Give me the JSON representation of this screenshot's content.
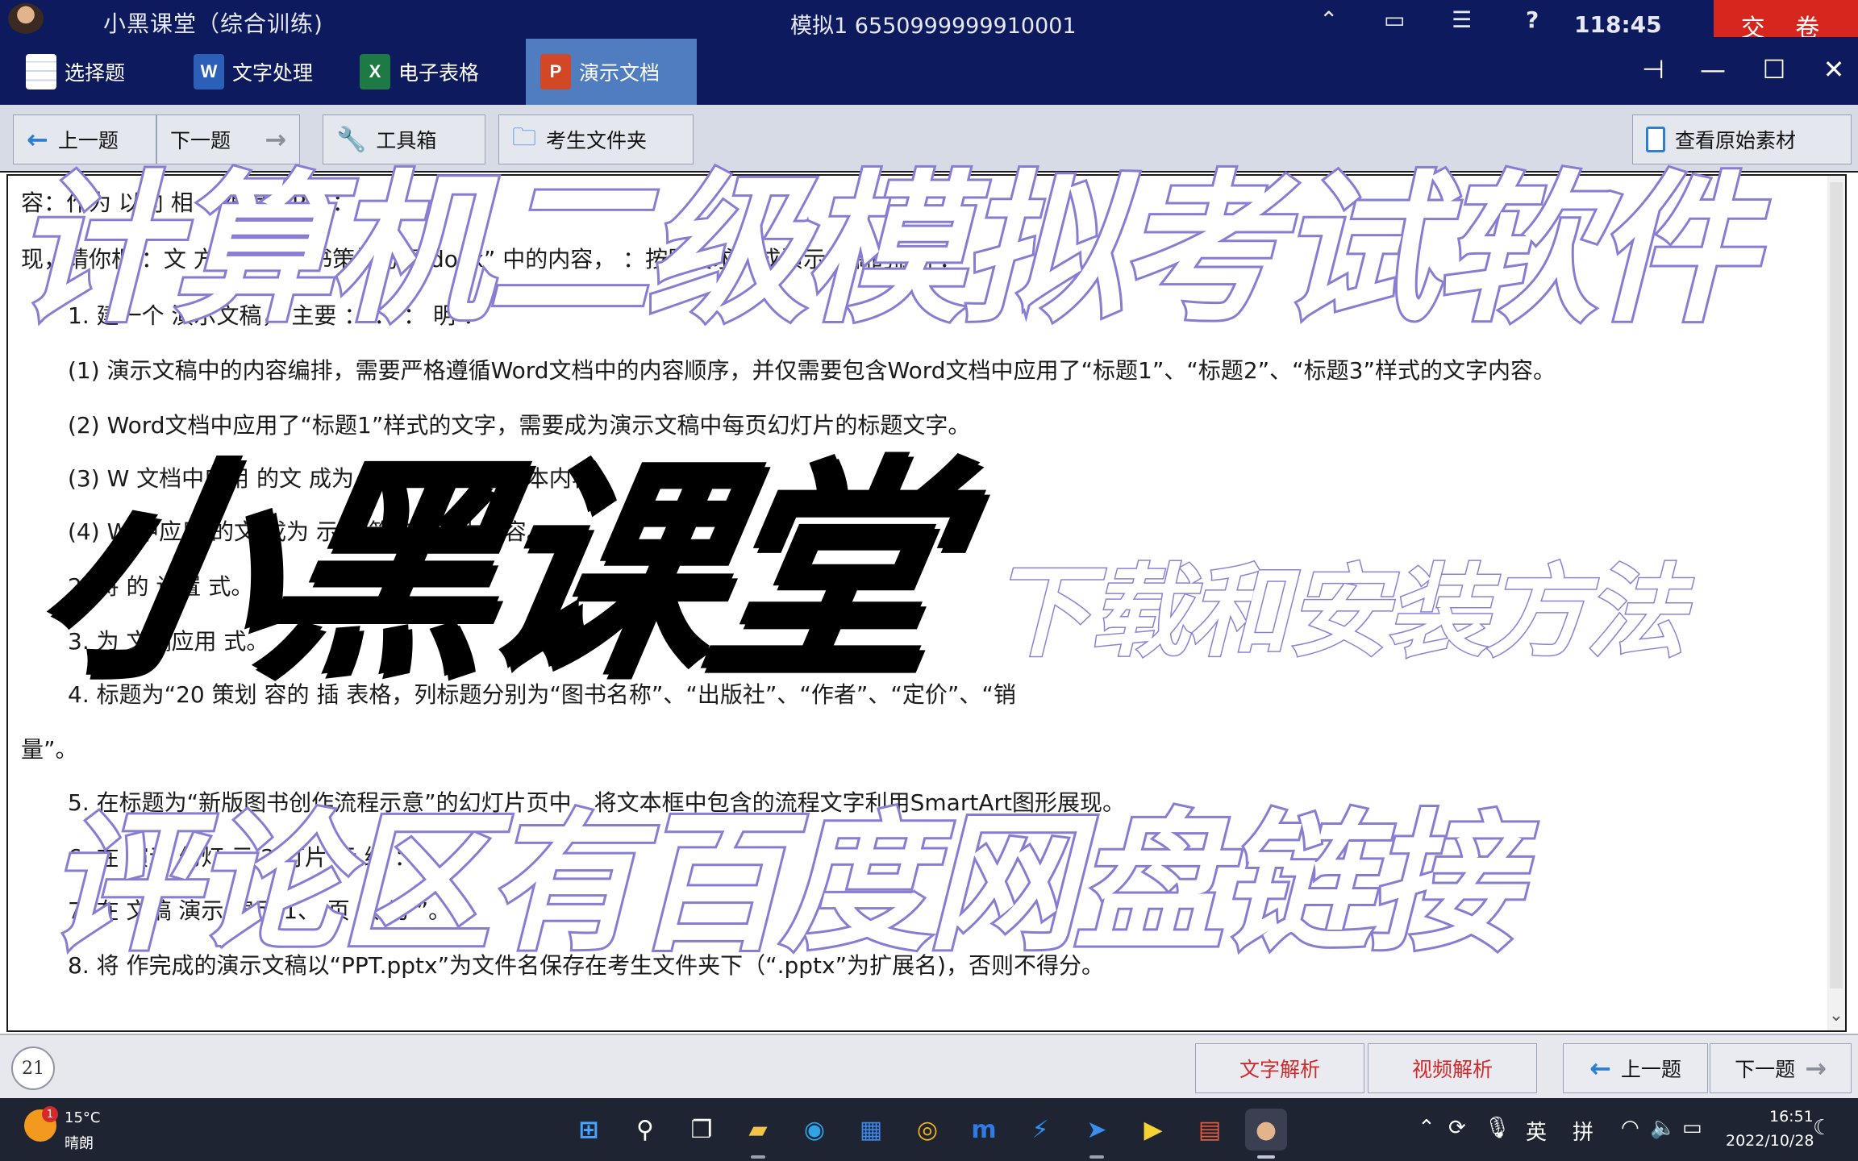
{
  "topbar": {
    "title": "小黑课堂（综合训练)",
    "exam_id": "模拟1  6550999999910001",
    "timer": "118:45",
    "submit_label": "交 卷",
    "icons": [
      "up-icon",
      "window-icon",
      "list-icon",
      "help-icon"
    ]
  },
  "tabs": [
    {
      "label": "选择题",
      "icon": "quiz"
    },
    {
      "label": "文字处理",
      "icon": "W"
    },
    {
      "label": "电子表格",
      "icon": "X"
    },
    {
      "label": "演示文档",
      "icon": "P"
    }
  ],
  "toolbar": {
    "prev_label": "上一题",
    "next_label": "下一题",
    "toolbox_label": "工具箱",
    "folder_label": "考生文件夹",
    "view_original_label": "查看原始素材"
  },
  "content": {
    "lines": [
      "容：作为  以向  相  ：编  大  rPoi  ：",
      "现，请你根  ：文  方  中的  “图书策划方案.docx”  中的内容，  ：按照要求完成演示文稿的制作：",
      "1.  建一个  演示文稿，  主要  ：  ：  ：  明  ：",
      "(1)   演示文稿中的内容编排，需要严格遵循Word文档中的内容顺序，并仅需要包含Word文档中应用了“标题1”、“标题2”、“标题3”样式的文字内容。",
      "(2)   Word文档中应用了“标题1”样式的文字，需要成为演示文稿中每页幻灯片的标题文字。",
      "(3)   W   文档中应用   的文   成为   示文   的第一级文本内容。",
      "(4)   W   中应用   的文   成为   示   的第二级文本内容。",
      "2.  将   的   设置   式。",
      "3.  为   文稿应用   式。",
      "4.   标题为“20   策划   容的   插   表格，列标题分别为“图书名称”、“出版社”、“作者”、“定价”、“销",
      "量”。",
      "5.  在标题为“新版图书创作流程示意”的幻灯片页中，将文本框中包含的流程文字利用SmartArt图形展现。",
      "6.  在   演示   幻灯   示   2   灯片   示   编   ：",
      "7.  在   文稿   演示   演示   1、   页   该   为   ”。",
      "8.  将   作完成的演示文稿以“PPT.pptx”为文件名保存在考生文件夹下（“.pptx”为扩展名)，否则不得分。"
    ]
  },
  "bottombar": {
    "question_number": "21",
    "text_analysis_label": "文字解析",
    "video_analysis_label": "视频解析",
    "prev_label": "上一题",
    "next_label": "下一题"
  },
  "taskbar": {
    "notification_count": "1",
    "temperature": "15°C",
    "weather": "晴朗",
    "lang_en": "英",
    "lang_pinyin": "拼",
    "time": "16:51",
    "date": "2022/10/28"
  },
  "overlay": {
    "headline": "计算机二级模拟考试软件",
    "brand": "小黑课堂",
    "subtitle": "下载和安装方法",
    "footer": "评论区有百度网盘链接"
  },
  "colors": {
    "titlebar_bg": "#0d1a5e",
    "active_tab": "#4f7dc0",
    "submit_red": "#d6261e",
    "accent_blue": "#2d7fd3",
    "overlay_purple": "#8a80d4",
    "analysis_red": "#d22a2a"
  }
}
